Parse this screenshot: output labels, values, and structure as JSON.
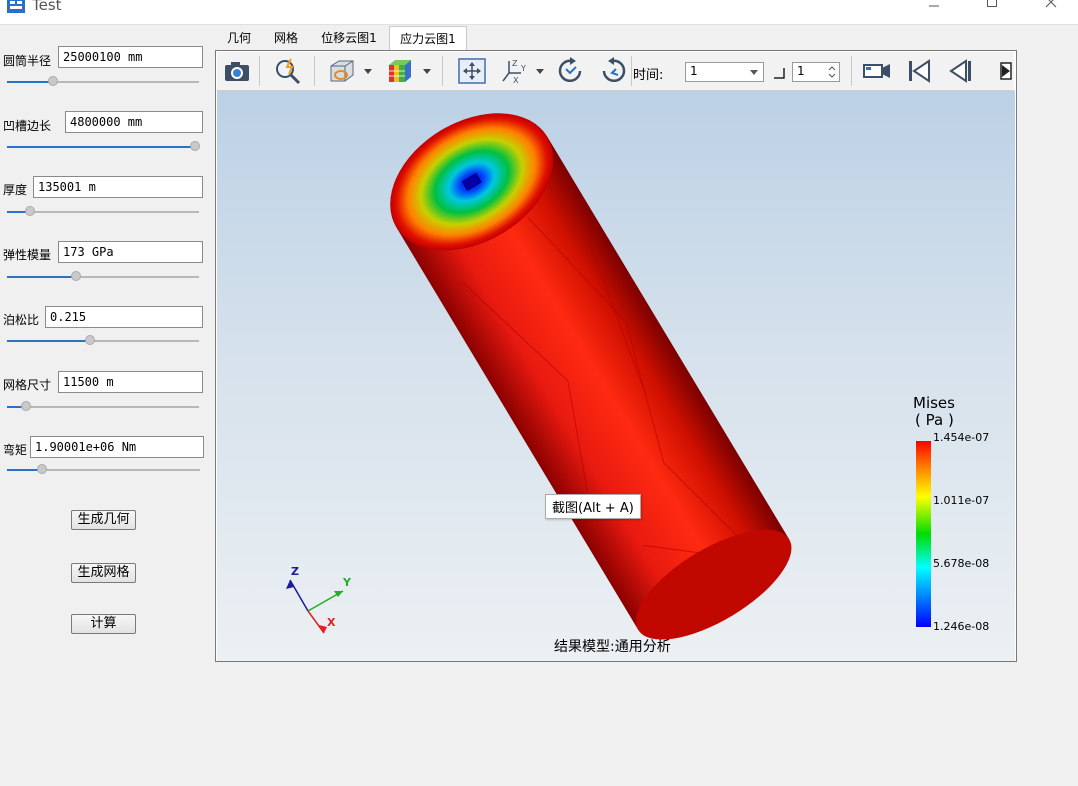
{
  "window": {
    "title": "Test",
    "minimize_icon": "minimize-icon",
    "maximize_icon": "maximize-icon",
    "close_icon": "close-icon"
  },
  "params": [
    {
      "label": "圆筒半径",
      "value": "25000100 mm",
      "slider": 0.24
    },
    {
      "label": "凹槽边长",
      "value": "4800000 mm",
      "slider": 1.0
    },
    {
      "label": "厚度",
      "value": "135001 m",
      "slider": 0.12
    },
    {
      "label": "弹性模量",
      "value": "173 GPa",
      "slider": 0.36
    },
    {
      "label": "泊松比",
      "value": "0.215",
      "slider": 0.43
    },
    {
      "label": "网格尺寸",
      "value": "11500 m",
      "slider": 0.1
    },
    {
      "label": "弯矩",
      "value": "1.90001e+06 Nm",
      "slider": 0.18
    }
  ],
  "actions": {
    "geometry": "生成几何",
    "mesh": "生成网格",
    "compute": "计算"
  },
  "tabs": [
    "几何",
    "网格",
    "位移云图1",
    "应力云图1"
  ],
  "active_tab": "应力云图1",
  "toolbar": {
    "time_label": "时间:",
    "time_value": "1",
    "step_value": "1",
    "icons": [
      "camera-icon",
      "zoom-icon",
      "display-mode-icon",
      "color-cube-icon",
      "fit-view-icon",
      "axes-icon",
      "rotate-cw-icon",
      "rotate-ccw-icon",
      "video-record-icon",
      "first-frame-icon",
      "previous-frame-icon",
      "next-frame-icon"
    ]
  },
  "tooltip": "截图(Alt + A)",
  "legend": {
    "title": "Mises",
    "unit": "( Pa )",
    "values": [
      "1.454e-07",
      "1.011e-07",
      "5.678e-08",
      "1.246e-08"
    ],
    "colors": [
      "#ff0000",
      "#ffff00",
      "#00dd00",
      "#00ffff",
      "#0000ff"
    ]
  },
  "axes": {
    "x": "X",
    "y": "Y",
    "z": "Z"
  },
  "caption": "结果模型:通用分析"
}
